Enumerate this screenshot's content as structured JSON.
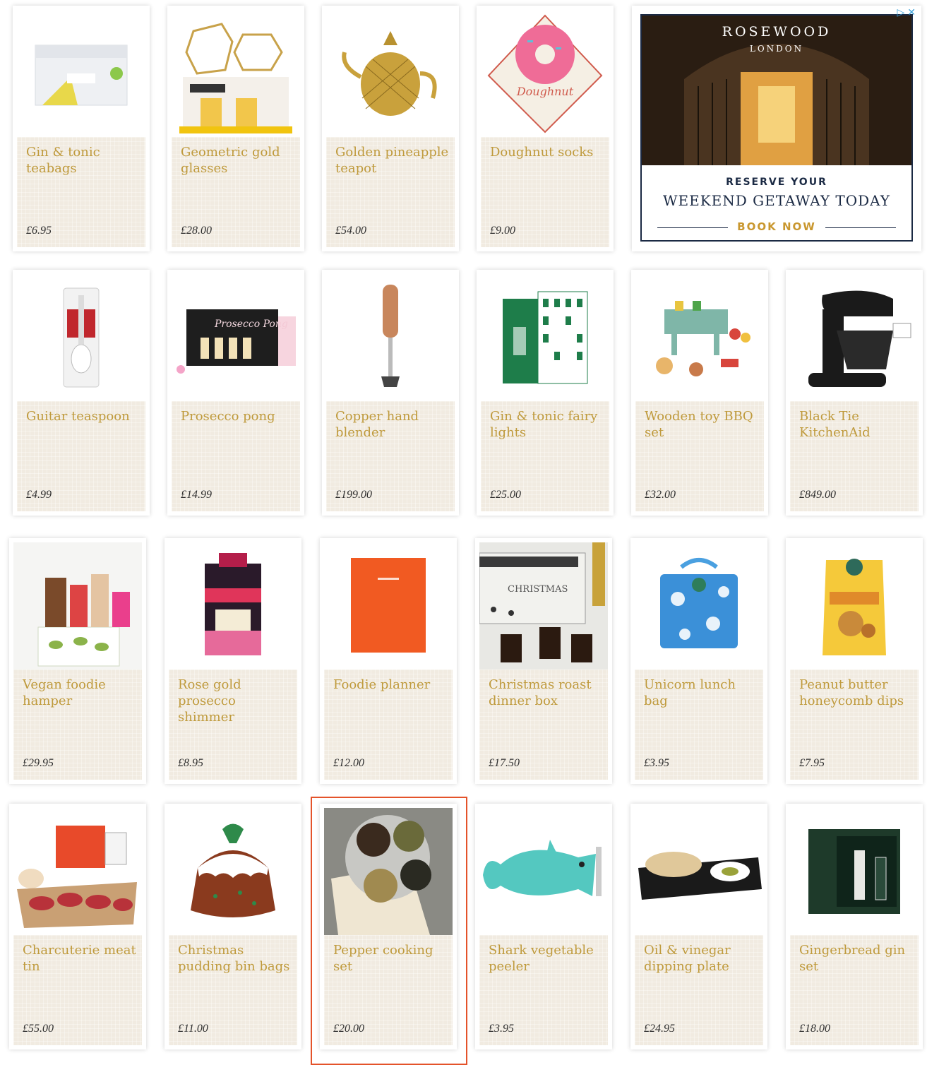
{
  "products": [
    {
      "name": "Gin & tonic teabags",
      "price": "£6.95",
      "icon": "teabag-box-icon"
    },
    {
      "name": "Geometric gold glasses",
      "price": "£28.00",
      "icon": "gold-glasses-icon"
    },
    {
      "name": "Golden pineapple teapot",
      "price": "£54.00",
      "icon": "pineapple-teapot-icon"
    },
    {
      "name": "Doughnut socks",
      "price": "£9.00",
      "icon": "doughnut-socks-icon"
    },
    {
      "name": "Guitar teaspoon",
      "price": "£4.99",
      "icon": "guitar-teaspoon-icon"
    },
    {
      "name": "Prosecco pong",
      "price": "£14.99",
      "icon": "prosecco-pong-icon"
    },
    {
      "name": "Copper hand blender",
      "price": "£199.00",
      "icon": "hand-blender-icon"
    },
    {
      "name": "Gin & tonic fairy lights",
      "price": "£25.00",
      "icon": "fairy-lights-box-icon"
    },
    {
      "name": "Wooden toy BBQ set",
      "price": "£32.00",
      "icon": "toy-bbq-icon"
    },
    {
      "name": "Black Tie KitchenAid",
      "price": "£849.00",
      "icon": "stand-mixer-icon"
    },
    {
      "name": "Vegan foodie hamper",
      "price": "£29.95",
      "icon": "hamper-icon"
    },
    {
      "name": "Rose gold prosecco shimmer",
      "price": "£8.95",
      "icon": "shimmer-box-icon"
    },
    {
      "name": "Foodie planner",
      "price": "£12.00",
      "icon": "planner-icon"
    },
    {
      "name": "Christmas roast dinner box",
      "price": "£17.50",
      "icon": "roast-box-icon"
    },
    {
      "name": "Unicorn lunch bag",
      "price": "£3.95",
      "icon": "lunch-bag-icon"
    },
    {
      "name": "Peanut butter honeycomb dips",
      "price": "£7.95",
      "icon": "snack-bag-icon"
    },
    {
      "name": "Charcuterie meat tin",
      "price": "£55.00",
      "icon": "charcuterie-icon"
    },
    {
      "name": "Christmas pudding bin bags",
      "price": "£11.00",
      "icon": "pudding-bag-icon"
    },
    {
      "name": "Pepper cooking set",
      "price": "£20.00",
      "icon": "pepper-tin-icon"
    },
    {
      "name": "Shark vegetable peeler",
      "price": "£3.95",
      "icon": "shark-peeler-icon"
    },
    {
      "name": "Oil & vinegar dipping plate",
      "price": "£24.95",
      "icon": "dipping-plate-icon"
    },
    {
      "name": "Gingerbread gin set",
      "price": "£18.00",
      "icon": "gin-set-icon"
    }
  ],
  "ad": {
    "brand": "ROSEWOOD",
    "city": "LONDON",
    "line1": "RESERVE YOUR",
    "line2": "WEEKEND GETAWAY TODAY",
    "cta": "BOOK NOW",
    "adchoices": "▷✕",
    "colors": {
      "navy": "#1b2a44",
      "gold": "#c9972f"
    }
  },
  "colors": {
    "product_name": "#bf9a3c",
    "price": "#2e2e2e",
    "info_bg": "#f1ebe1",
    "highlight": "#e4532a"
  }
}
